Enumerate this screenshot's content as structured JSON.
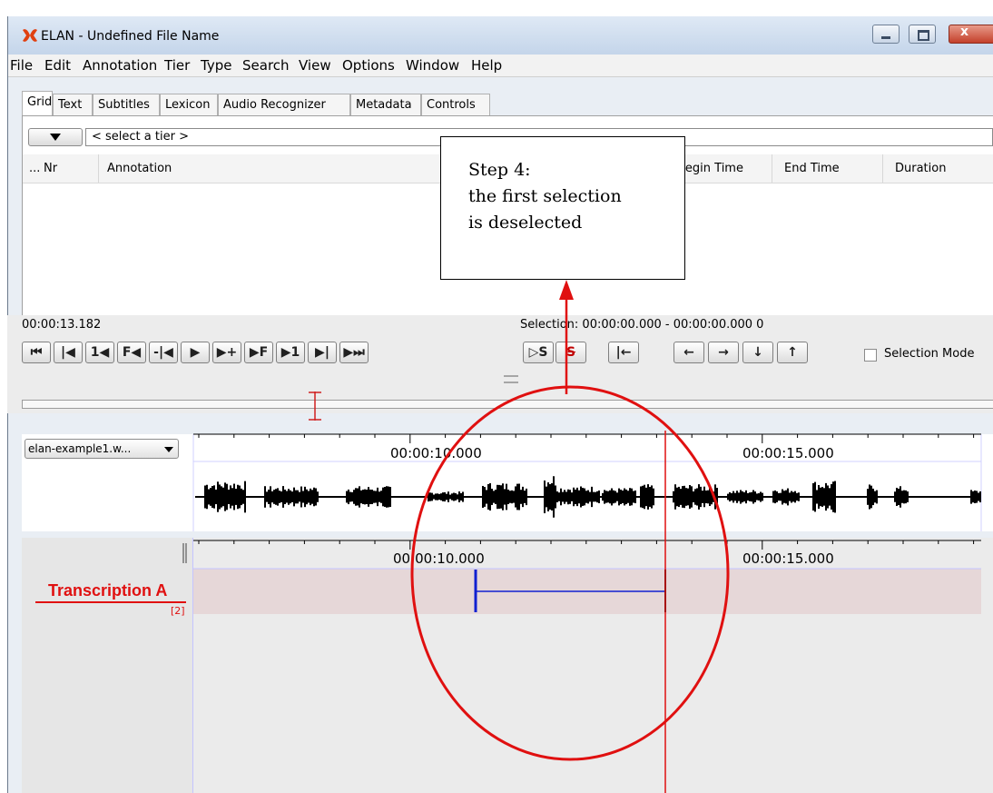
{
  "window": {
    "title": "ELAN - Undefined File Name"
  },
  "menu": [
    "File",
    "Edit",
    "Annotation",
    "Tier",
    "Type",
    "Search",
    "View",
    "Options",
    "Window",
    "Help"
  ],
  "tabs": [
    "Grid",
    "Text",
    "Subtitles",
    "Lexicon",
    "Audio Recognizer",
    "Metadata",
    "Controls"
  ],
  "grid": {
    "tier_placeholder": "< select a tier >",
    "columns": [
      "...",
      "Nr",
      "Annotation",
      "Begin Time",
      "End Time",
      "Duration"
    ]
  },
  "controls": {
    "current_time": "00:00:13.182",
    "selection": "Selection: 00:00:00.000 - 00:00:00.000  0",
    "selection_mode_label": "Selection Mode",
    "buttons": [
      "⏮",
      "|◀",
      "1◀",
      "F◀",
      "-|◀",
      "▶",
      "▶+",
      "▶F",
      "▶1",
      "▶|",
      "▶⏭",
      "▷S",
      "S",
      "|←",
      "←",
      "→",
      "↓",
      "↑"
    ]
  },
  "media": {
    "file": "elan-example1.w..."
  },
  "waveform": {
    "ticks": [
      "00:00:10.000",
      "00:00:15.000"
    ]
  },
  "timeline": {
    "ticks": [
      "00:00:10.000",
      "00:00:15.000"
    ],
    "tier_name": "Transcription A",
    "tier_count": "[2]"
  },
  "callout": {
    "lines": [
      "Step 4:",
      "the first selection",
      "is deselected"
    ]
  },
  "colors": {
    "accent_red": "#e01010",
    "annotation_blue": "#1020d0",
    "tier_row": "#e6d7d8"
  }
}
